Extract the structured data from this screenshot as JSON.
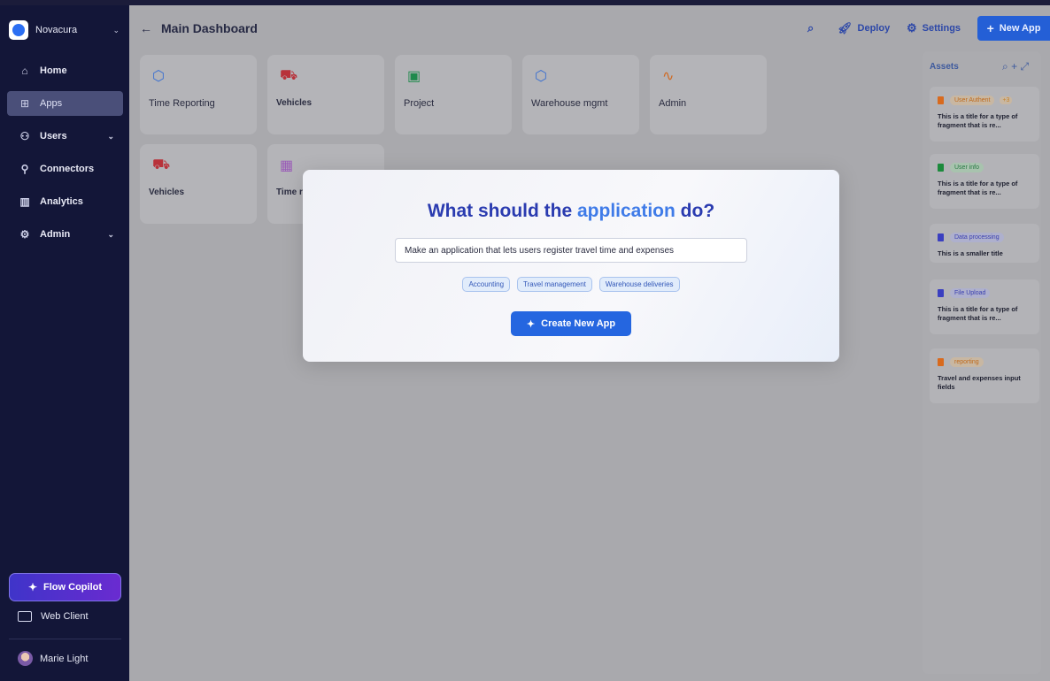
{
  "brand": {
    "name": "Novacura"
  },
  "nav": [
    {
      "label": "Home",
      "icon": "home-icon",
      "glyph": "⌂",
      "active": false,
      "chevron": false
    },
    {
      "label": "Apps",
      "icon": "apps-grid-icon",
      "glyph": "⊞",
      "active": true,
      "chevron": false
    },
    {
      "label": "Users",
      "icon": "users-icon",
      "glyph": "⚇",
      "active": false,
      "chevron": true
    },
    {
      "label": "Connectors",
      "icon": "connector-plug-icon",
      "glyph": "⚲",
      "active": false,
      "chevron": false
    },
    {
      "label": "Analytics",
      "icon": "bar-chart-icon",
      "glyph": "▥",
      "active": false,
      "chevron": false
    },
    {
      "label": "Admin",
      "icon": "gear-icon",
      "glyph": "⚙",
      "active": false,
      "chevron": true
    }
  ],
  "copilot": {
    "label": "Flow Copilot"
  },
  "webclient": {
    "label": "Web Client"
  },
  "user": {
    "name": "Marie Light"
  },
  "header": {
    "title": "Main Dashboard",
    "deploy": "Deploy",
    "settings": "Settings",
    "new_app": "New App"
  },
  "tiles": [
    {
      "name": "Time Reporting",
      "icon": "cube-icon",
      "glyph": "⬡",
      "color": "#3a6fd0",
      "bold": false
    },
    {
      "name": "Vehicles",
      "icon": "car-icon",
      "glyph": "⛟",
      "color": "#b8323a",
      "bold": true
    },
    {
      "name": "Project",
      "icon": "contact-book-icon",
      "glyph": "▣",
      "color": "#1f8a4c",
      "bold": false
    },
    {
      "name": "Warehouse mgmt",
      "icon": "cube-icon",
      "glyph": "⬡",
      "color": "#3a6fd0",
      "bold": false
    },
    {
      "name": "Admin",
      "icon": "activity-icon",
      "glyph": "∿",
      "color": "#d06a22",
      "bold": false
    },
    {
      "name": "Vehicles",
      "icon": "car-icon",
      "glyph": "⛟",
      "color": "#b8323a",
      "bold": true
    },
    {
      "name": "Time r",
      "icon": "calendar-icon",
      "glyph": "▦",
      "color": "#9a5ab8",
      "bold": true
    }
  ],
  "assets": {
    "title": "Assets",
    "items": [
      {
        "tag": "User Authent",
        "extra": "+3",
        "text": "This is a title for a type of fragment that is re...",
        "icon_color": "#d86a1e",
        "tag_color": "#c8b7a2",
        "tag_text_color": "#c06a1a"
      },
      {
        "tag": "User info",
        "extra": "",
        "text": "This is a title for a type of fragment that is re...",
        "icon_color": "#1c8a3c",
        "tag_color": "#a8c3ae",
        "tag_text_color": "#2a7a45"
      },
      {
        "tag": "Data processing",
        "extra": "",
        "text": "This is a smaller title",
        "icon_color": "#3a3fc0",
        "tag_color": "#aeb0cd",
        "tag_text_color": "#3a3fb0"
      },
      {
        "tag": "File Upload",
        "extra": "",
        "text": "This is a title for a type of fragment that is re...",
        "icon_color": "#3a3fc0",
        "tag_color": "#aeb0cd",
        "tag_text_color": "#3a3fb0"
      },
      {
        "tag": "reporting",
        "extra": "",
        "text": "Travel and expenses input fields",
        "icon_color": "#d86a1e",
        "tag_color": "#c8b7a2",
        "tag_text_color": "#c06a1a"
      }
    ]
  },
  "modal": {
    "question_part1": "What should the ",
    "question_part2": "application",
    "question_part3": " do?",
    "prompt_value": "Make an application that lets users register travel time and expenses",
    "chips": [
      "Accounting",
      "Travel management",
      "Warehouse deliveries"
    ],
    "create_label": "Create New App"
  }
}
